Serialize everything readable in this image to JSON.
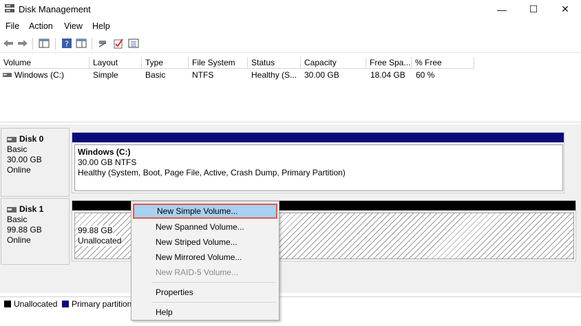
{
  "window": {
    "title": "Disk Management",
    "minimize_glyph": "—",
    "maximize_glyph": "☐",
    "close_glyph": "✕"
  },
  "menu": [
    "File",
    "Action",
    "View",
    "Help"
  ],
  "toolbar": {
    "icons": [
      "back-arrow-icon",
      "forward-arrow-icon",
      "show-hide-console-tree-icon",
      "help-icon",
      "properties-icon",
      "connect-icon",
      "check-icon",
      "list-icon"
    ]
  },
  "volume_list": {
    "columns": [
      "Volume",
      "Layout",
      "Type",
      "File System",
      "Status",
      "Capacity",
      "Free Spa...",
      "% Free"
    ],
    "rows": [
      [
        "Windows (C:)",
        "Simple",
        "Basic",
        "NTFS",
        "Healthy (S...",
        "30.00 GB",
        "18.04 GB",
        "60 %"
      ]
    ]
  },
  "disks": [
    {
      "name": "Disk 0",
      "type": "Basic",
      "size": "30.00 GB",
      "state": "Online",
      "partition": {
        "title": "Windows  (C:)",
        "size": "30.00 GB NTFS",
        "status": "Healthy (System, Boot, Page File, Active, Crash Dump, Primary Partition)"
      }
    },
    {
      "name": "Disk 1",
      "type": "Basic",
      "size": "99.88 GB",
      "state": "Online",
      "partition": {
        "size": "99.88 GB",
        "status": "Unallocated"
      }
    }
  ],
  "legend": [
    {
      "label": "Unallocated",
      "color": "#000000"
    },
    {
      "label": "Primary partition",
      "color": "#0a0a7a"
    }
  ],
  "context_menu": {
    "items": [
      {
        "label": "New Simple Volume...",
        "enabled": true,
        "highlighted": true
      },
      {
        "label": "New Spanned Volume...",
        "enabled": true
      },
      {
        "label": "New Striped Volume...",
        "enabled": true
      },
      {
        "label": "New Mirrored Volume...",
        "enabled": true
      },
      {
        "label": "New RAID-5 Volume...",
        "enabled": false
      },
      {
        "label": "Properties",
        "enabled": true
      },
      {
        "label": "Help",
        "enabled": true
      }
    ]
  },
  "colors": {
    "primary_partition_bar": "#0a0a7a",
    "unallocated_bar": "#000000",
    "highlight_border": "#e05a4a",
    "highlight_fill": "#a8d0f0"
  }
}
